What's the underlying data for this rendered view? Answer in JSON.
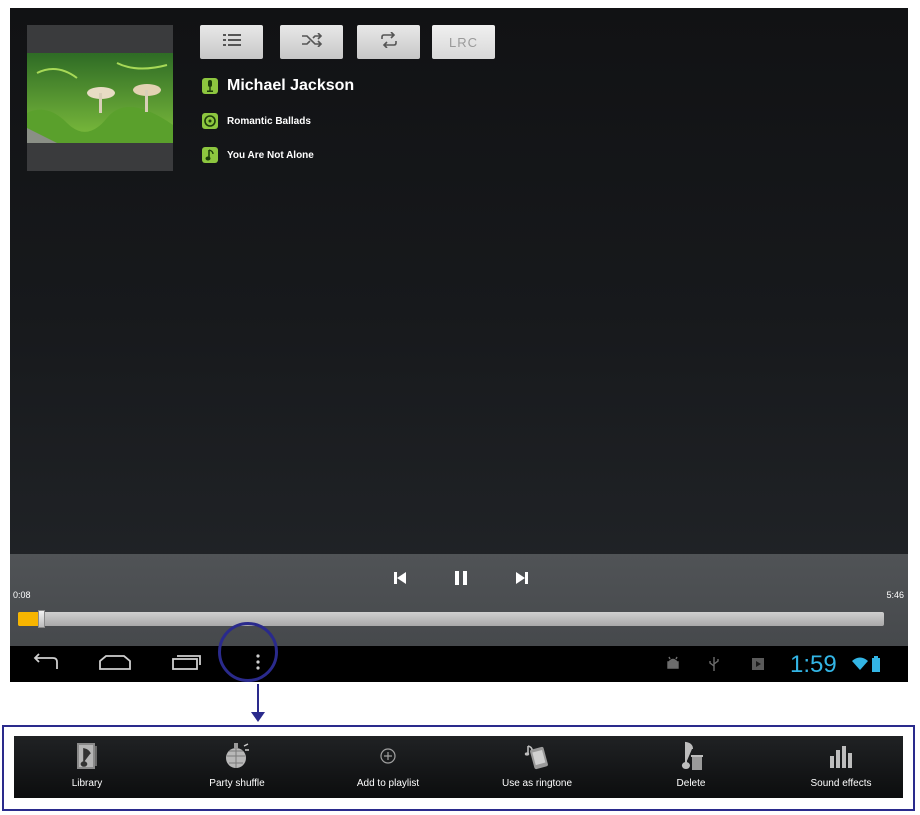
{
  "player": {
    "top_buttons": {
      "lrc_label": "LRC"
    },
    "artist": "Michael Jackson",
    "album": "Romantic Ballads",
    "song": "You Are Not Alone",
    "elapsed": "0:08",
    "total": "5:46",
    "progress_fraction": 0.024
  },
  "status_bar": {
    "clock": "1:59"
  },
  "menu": {
    "items": [
      {
        "label": "Library",
        "icon": "library-icon"
      },
      {
        "label": "Party shuffle",
        "icon": "party-shuffle-icon"
      },
      {
        "label": "Add to playlist",
        "icon": "add-to-playlist-icon"
      },
      {
        "label": "Use as ringtone",
        "icon": "ringtone-icon"
      },
      {
        "label": "Delete",
        "icon": "delete-icon"
      },
      {
        "label": "Sound effects",
        "icon": "sound-effects-icon"
      }
    ]
  },
  "colors": {
    "accent_blue": "#33b5e5",
    "progress_fill": "#f7b500",
    "highlight": "#2a2a8c",
    "meta_icon_green": "#8dc63f"
  }
}
